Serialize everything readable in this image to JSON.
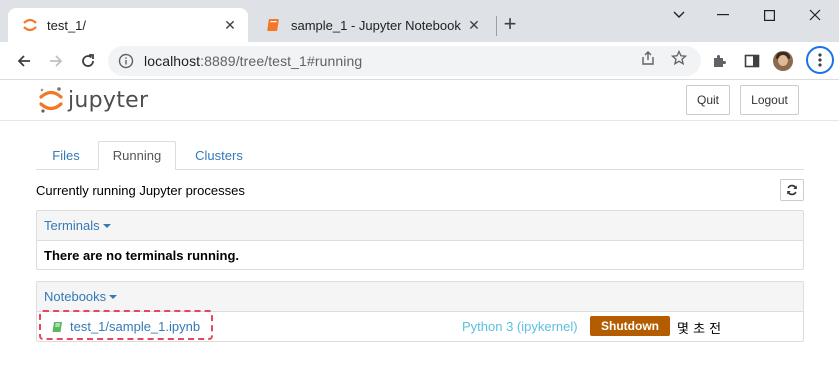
{
  "browser": {
    "tabs": [
      {
        "title": "test_1/",
        "active": true
      },
      {
        "title": "sample_1 - Jupyter Notebook",
        "active": false
      }
    ],
    "url_host": "localhost",
    "url_rest": ":8889/tree/test_1#running"
  },
  "jupyter": {
    "logo_text": "jupyter",
    "quit_label": "Quit",
    "logout_label": "Logout",
    "tabs": [
      "Files",
      "Running",
      "Clusters"
    ],
    "active_tab": "Running",
    "running_header": "Currently running Jupyter processes",
    "terminals": {
      "title": "Terminals",
      "empty_message": "There are no terminals running."
    },
    "notebooks": {
      "title": "Notebooks",
      "items": [
        {
          "path": "test_1/sample_1.ipynb",
          "kernel": "Python 3 (ipykernel)",
          "action": "Shutdown",
          "time": "몇 초 전"
        }
      ]
    }
  },
  "colors": {
    "link": "#337ab7",
    "kernel": "#5bc0de",
    "shutdown_bg": "#b35c00",
    "highlight": "#e8455f",
    "jupyter_orange": "#f37726"
  }
}
